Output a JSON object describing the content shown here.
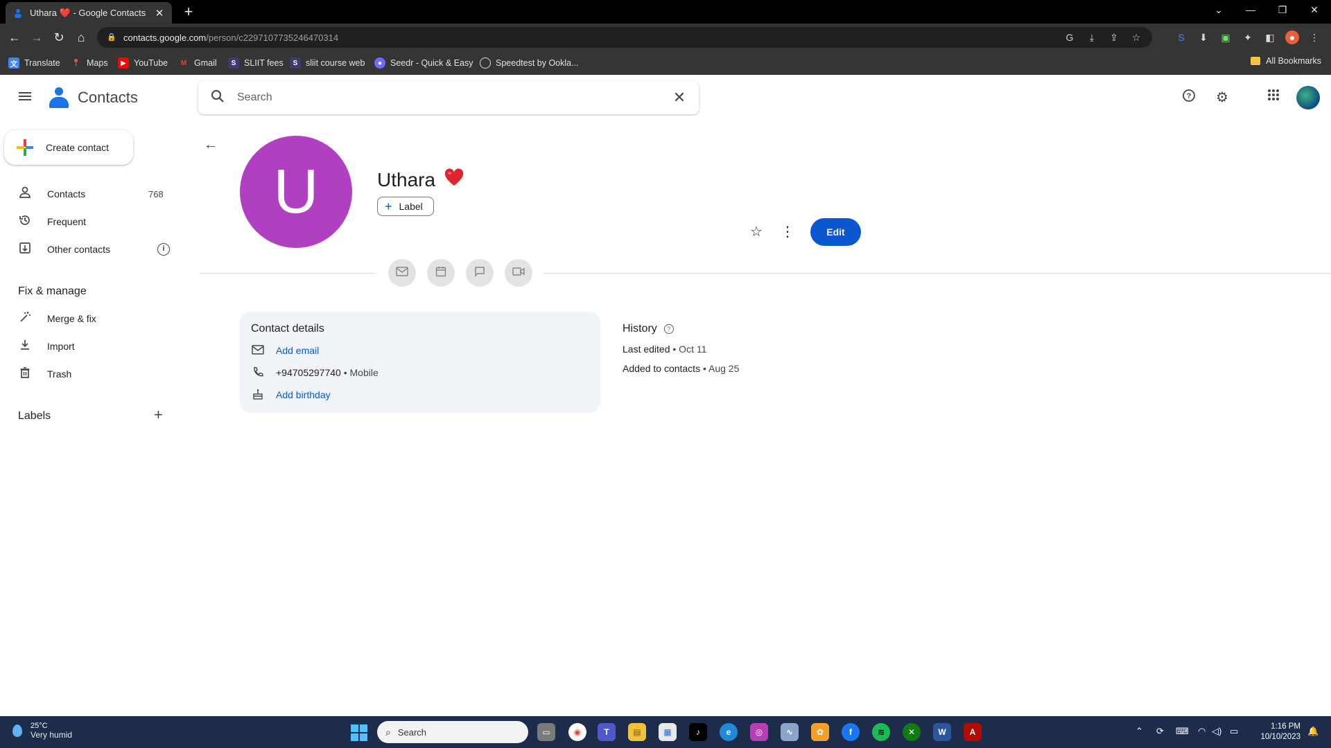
{
  "browser": {
    "tab_title": "Uthara ❤️ - Google Contacts",
    "url_host": "contacts.google.com",
    "url_path": "/person/c2297107735246470314",
    "bookmarks": [
      "Translate",
      "Maps",
      "YouTube",
      "Gmail",
      "SLIIT fees",
      "sliit course web",
      "Seedr - Quick & Easy",
      "Speedtest by Ookla..."
    ],
    "all_bookmarks": "All Bookmarks"
  },
  "app": {
    "name": "Contacts",
    "search_placeholder": "Search"
  },
  "sidebar": {
    "create_label": "Create contact",
    "items": [
      {
        "label": "Contacts",
        "count": "768",
        "icon": "person-icon"
      },
      {
        "label": "Frequent",
        "icon": "history-icon"
      },
      {
        "label": "Other contacts",
        "icon": "add-box-icon"
      }
    ],
    "fix_heading": "Fix & manage",
    "fix_items": [
      {
        "label": "Merge & fix",
        "icon": "wand-icon"
      },
      {
        "label": "Import",
        "icon": "download-icon"
      },
      {
        "label": "Trash",
        "icon": "trash-icon"
      }
    ],
    "labels_heading": "Labels"
  },
  "contact": {
    "initial": "U",
    "name": "Uthara",
    "name_emoji": "❤️",
    "label_button": "Label",
    "edit_button": "Edit",
    "avatar_color": "#b03fc2",
    "details_heading": "Contact details",
    "add_email": "Add email",
    "phone": "+94705297740",
    "phone_type": "• Mobile",
    "add_birthday": "Add birthday",
    "history_heading": "History",
    "history": [
      {
        "label": "Last edited",
        "value": "• Oct 11"
      },
      {
        "label": "Added to contacts",
        "value": "• Aug 25"
      }
    ]
  },
  "taskbar": {
    "temp": "25°C",
    "weather": "Very humid",
    "search": "Search",
    "time": "1:16 PM",
    "date": "10/10/2023"
  },
  "colors": {
    "primary": "#0b57d0",
    "card": "#f0f4f9",
    "chrome_dark": "#353535"
  }
}
